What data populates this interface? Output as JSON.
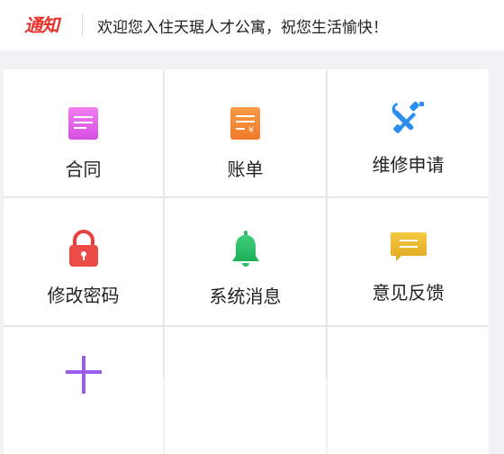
{
  "notice": {
    "tag": "通知",
    "text": "欢迎您入住天琚人才公寓，祝您生活愉快！"
  },
  "menu": [
    {
      "label": "合同",
      "icon": "contract-icon",
      "color": "#e05be4"
    },
    {
      "label": "账单",
      "icon": "bill-icon",
      "color": "#f5873a"
    },
    {
      "label": "维修申请",
      "icon": "repair-tools-icon",
      "color": "#2d8ef0"
    },
    {
      "label": "修改密码",
      "icon": "lock-icon",
      "color": "#e8403c"
    },
    {
      "label": "系统消息",
      "icon": "bell-icon",
      "color": "#2fbf6a"
    },
    {
      "label": "意见反馈",
      "icon": "feedback-icon",
      "color": "#e9b62a"
    },
    {
      "label": "",
      "icon": "plus-icon",
      "color": "#9b5cf0"
    }
  ]
}
